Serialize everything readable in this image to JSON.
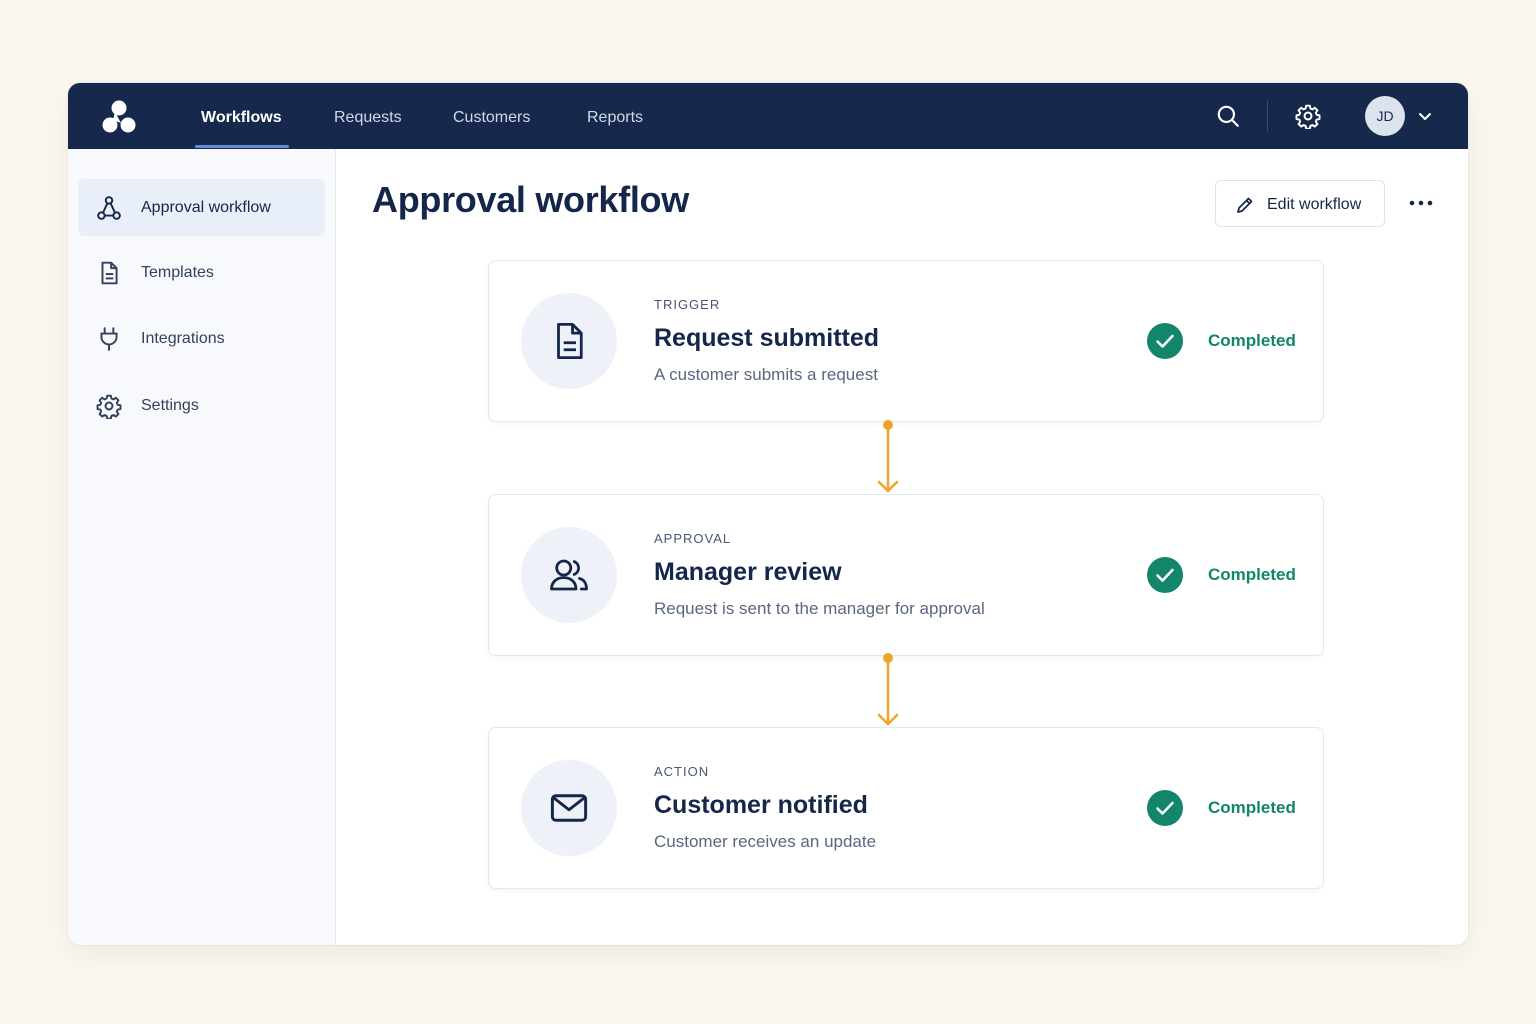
{
  "nav": {
    "tabs": [
      {
        "label": "Workflows",
        "active": true
      },
      {
        "label": "Requests",
        "active": false
      },
      {
        "label": "Customers",
        "active": false
      },
      {
        "label": "Reports",
        "active": false
      }
    ],
    "search_icon": "search-icon",
    "settings_icon": "gear-icon",
    "avatar_initials": "JD"
  },
  "sidebar": {
    "items": [
      {
        "label": "Approval workflow",
        "icon": "workflow-icon",
        "active": true
      },
      {
        "label": "Templates",
        "icon": "document-icon",
        "active": false
      },
      {
        "label": "Integrations",
        "icon": "plug-icon",
        "active": false
      },
      {
        "label": "Settings",
        "icon": "gear-icon",
        "active": false
      }
    ]
  },
  "main": {
    "title": "Approval workflow",
    "edit_label": "Edit workflow"
  },
  "steps": [
    {
      "kind": "TRIGGER",
      "title": "Request submitted",
      "description": "A customer submits a request",
      "status": "Completed",
      "icon": "document-icon"
    },
    {
      "kind": "APPROVAL",
      "title": "Manager review",
      "description": "Request is sent to the manager for approval",
      "status": "Completed",
      "icon": "users-icon"
    },
    {
      "kind": "ACTION",
      "title": "Customer notified",
      "description": "Customer receives an update",
      "status": "Completed",
      "icon": "mail-icon"
    }
  ],
  "colors": {
    "nav_bg": "#16294d",
    "accent": "#f0a32a",
    "success": "#13856a"
  }
}
